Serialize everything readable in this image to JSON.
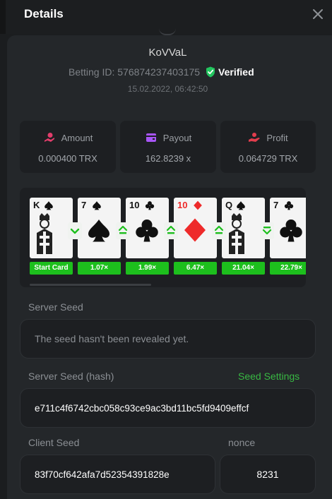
{
  "header": {
    "title": "Details"
  },
  "user": {
    "username": "KoVVaL",
    "betting_id": "Betting ID: 576874237403175",
    "verified_label": "Verified",
    "timestamp": "15.02.2022, 06:42:50"
  },
  "stats": [
    {
      "label": "Amount",
      "value": "0.000400 TRX",
      "icon": "coins-icon",
      "color": "#e23d6b"
    },
    {
      "label": "Payout",
      "value": "162.8239 x",
      "icon": "wallet-icon",
      "color": "#a855f7"
    },
    {
      "label": "Profit",
      "value": "0.064729 TRX",
      "icon": "hand-coins-icon",
      "color": "#e23d4d"
    }
  ],
  "cards": [
    {
      "rank": "K",
      "suit": "spades",
      "face": true
    },
    {
      "rank": "7",
      "suit": "spades",
      "face": false
    },
    {
      "rank": "10",
      "suit": "clubs",
      "face": false
    },
    {
      "rank": "10",
      "suit": "diamonds",
      "face": false
    },
    {
      "rank": "Q",
      "suit": "spades",
      "face": true
    },
    {
      "rank": "7",
      "suit": "clubs",
      "face": false
    }
  ],
  "guesses": [
    "lower",
    "higher",
    "higher",
    "higher",
    "lower-or-same"
  ],
  "multipliers": [
    "Start Card",
    "1.07×",
    "1.99×",
    "6.47×",
    "21.04×",
    "22.79×"
  ],
  "server_seed": {
    "label": "Server Seed",
    "value": "The seed hasn't been revealed yet."
  },
  "server_seed_hash": {
    "label": "Server Seed (hash)",
    "link": "Seed Settings",
    "value": "e711c4f6742cbc058c93ce9ac3bd11bc5fd9409effcf"
  },
  "client_seed": {
    "label": "Client Seed",
    "value": "83f70cf642afa7d52354391828e"
  },
  "nonce": {
    "label": "nonce",
    "value": "8231"
  },
  "colors": {
    "accent_green": "#1dbf1d",
    "link_green": "#38b843",
    "verified_green": "#22c55e",
    "panel_bg": "#24272a",
    "box_bg": "#1d1f22"
  }
}
